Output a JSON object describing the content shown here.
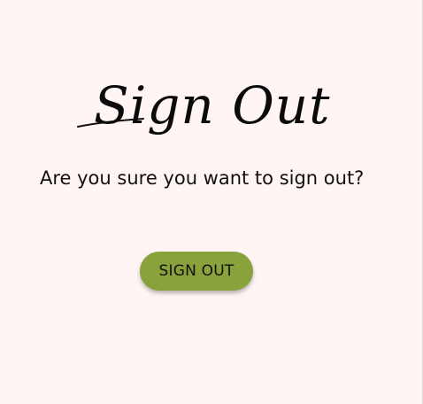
{
  "page": {
    "title": "Sign Out",
    "prompt": "Are you sure you want to sign out?",
    "button_label": "SIGN OUT"
  },
  "colors": {
    "background": "#fff5f4",
    "button": "#89a23b",
    "text": "#111111"
  }
}
